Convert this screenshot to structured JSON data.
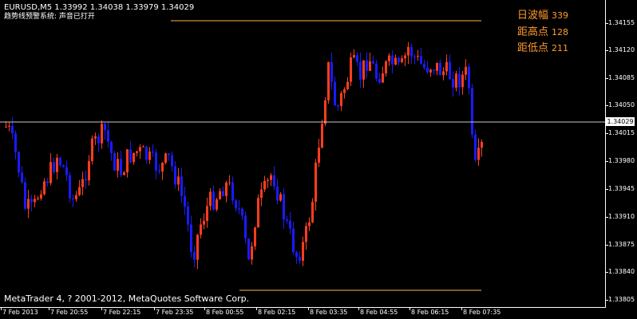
{
  "header": {
    "symbol_info": "EURUSD,M5  1.33992 1.34038 1.33979 1.34029",
    "indicator_status": "趋势线预警系统: 声音已打开"
  },
  "stats": [
    {
      "label": "日波幅",
      "value": "339"
    },
    {
      "label": "距高点",
      "value": "128"
    },
    {
      "label": "距低点",
      "value": "211"
    }
  ],
  "price_axis": {
    "labels": [
      "1.34155",
      "1.34120",
      "1.34085",
      "1.34050",
      "1.34015",
      "1.33980",
      "1.33945",
      "1.33910",
      "1.33875",
      "1.33840",
      "1.33805"
    ],
    "current_price": "1.34029"
  },
  "time_axis": {
    "labels": [
      "7 Feb 2013",
      "7 Feb 20:55",
      "7 Feb 22:15",
      "7 Feb 23:35",
      "8 Feb 00:55",
      "8 Feb 02:15",
      "8 Feb 03:35",
      "8 Feb 04:55",
      "8 Feb 06:15",
      "8 Feb 07:35"
    ]
  },
  "footer": {
    "copyright": "MetaTrader 4, ? 2001-2012, MetaQuotes Software Corp."
  },
  "colors": {
    "background": "#000000",
    "bull": "#ff3d1f",
    "bear": "#1a1aff",
    "level_line": "#ffb347",
    "axis": "#ffffff",
    "stats_text": "#ff9a2e"
  },
  "chart_data": {
    "type": "candlestick",
    "symbol": "EURUSD",
    "timeframe": "M5",
    "ohlc_current": {
      "open": 1.33992,
      "high": 1.34038,
      "low": 1.33979,
      "close": 1.34029
    },
    "ylim": [
      1.33805,
      1.34165
    ],
    "day_high": 1.34157,
    "day_low": 1.33818,
    "day_range_points": 339,
    "from_high_points": 128,
    "from_low_points": 211
  }
}
